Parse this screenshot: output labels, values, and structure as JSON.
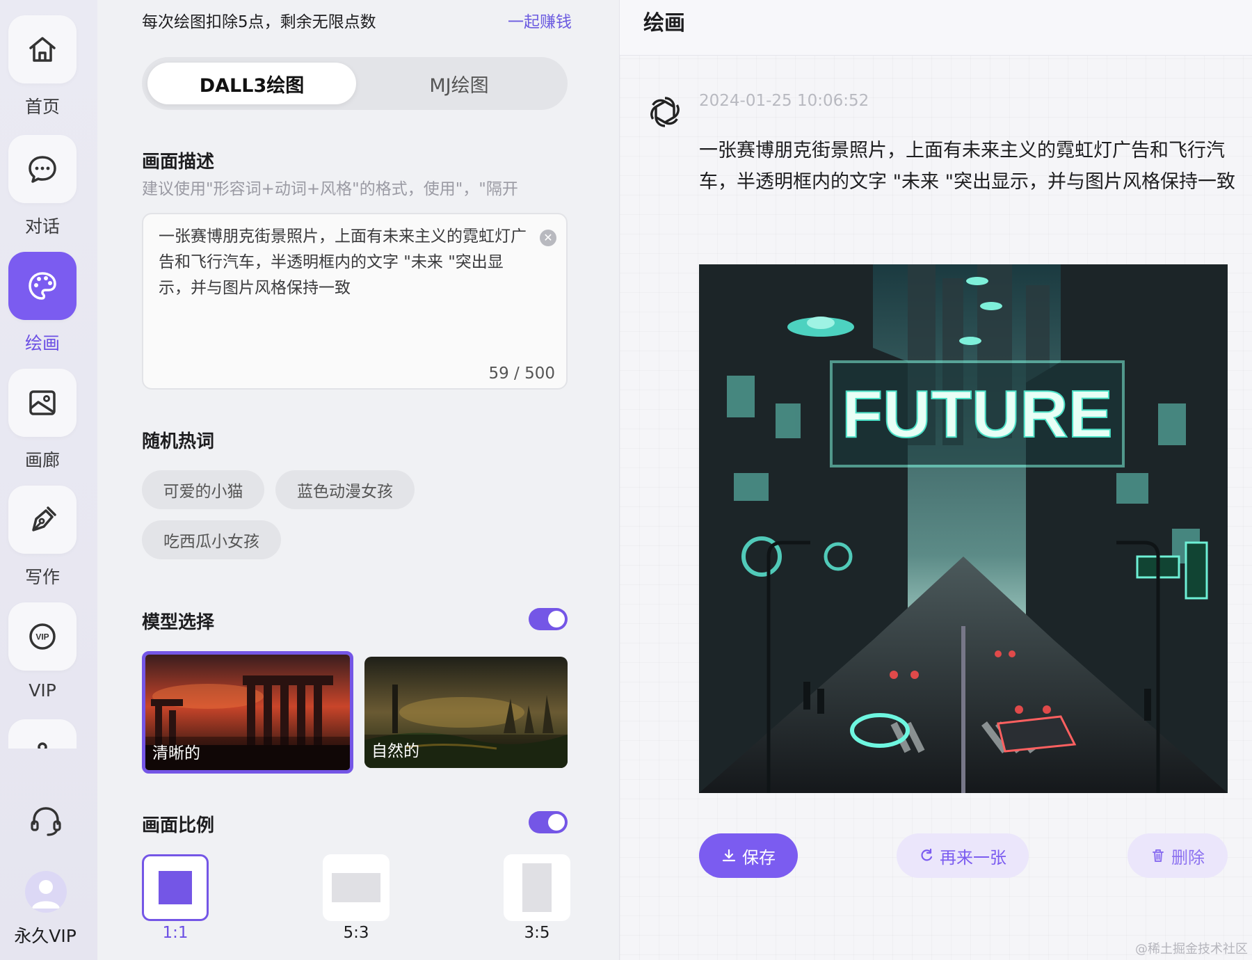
{
  "nav": {
    "items": [
      {
        "label": "首页",
        "icon": "home-icon"
      },
      {
        "label": "对话",
        "icon": "chat-icon"
      },
      {
        "label": "绘画",
        "icon": "palette-icon",
        "active": true
      },
      {
        "label": "画廊",
        "icon": "gallery-icon"
      },
      {
        "label": "写作",
        "icon": "pen-icon"
      },
      {
        "label": "VIP",
        "icon": "vip-icon"
      }
    ],
    "support_icon": "headset-icon",
    "user_label": "永久VIP"
  },
  "panel": {
    "points_text": "每次绘图扣除5点，剩余无限点数",
    "earn_link": "一起赚钱",
    "tabs": [
      "DALL3绘图",
      "MJ绘图"
    ],
    "description": {
      "heading": "画面描述",
      "hint": "建议使用\"形容词+动词+风格\"的格式，使用\"，\"隔开",
      "value": "一张赛博朋克街景照片，上面有未来主义的霓虹灯广告和飞行汽车，半透明框内的文字 \"未来 \"突出显示，并与图片风格保持一致",
      "counter": "59 / 500"
    },
    "hot_words": {
      "heading": "随机热词",
      "chips": [
        "可爱的小猫",
        "蓝色动漫女孩",
        "吃西瓜小女孩"
      ]
    },
    "model": {
      "heading": "模型选择",
      "toggle_on": true,
      "options": [
        {
          "label": "清晰的",
          "selected": true
        },
        {
          "label": "自然的",
          "selected": false
        }
      ]
    },
    "ratio": {
      "heading": "画面比例",
      "toggle_on": true,
      "options": [
        {
          "label": "1:1",
          "selected": true
        },
        {
          "label": "5:3",
          "selected": false
        },
        {
          "label": "3:5",
          "selected": false
        }
      ]
    }
  },
  "result": {
    "title": "绘画",
    "timestamp": "2024-01-25 10:06:52",
    "prompt": "一张赛博朋克街景照片，上面有未来主义的霓虹灯广告和飞行汽车，半透明框内的文字 \"未来 \"突出显示，并与图片风格保持一致",
    "image_text": "FUTURE",
    "buttons": {
      "save": "保存",
      "again": "再来一张",
      "delete": "删除"
    }
  },
  "watermark": "@稀土掘金技术社区",
  "colors": {
    "accent": "#7b5cf0",
    "accent_light": "#ebe6fb",
    "panel_bg": "#f0f1f4"
  }
}
